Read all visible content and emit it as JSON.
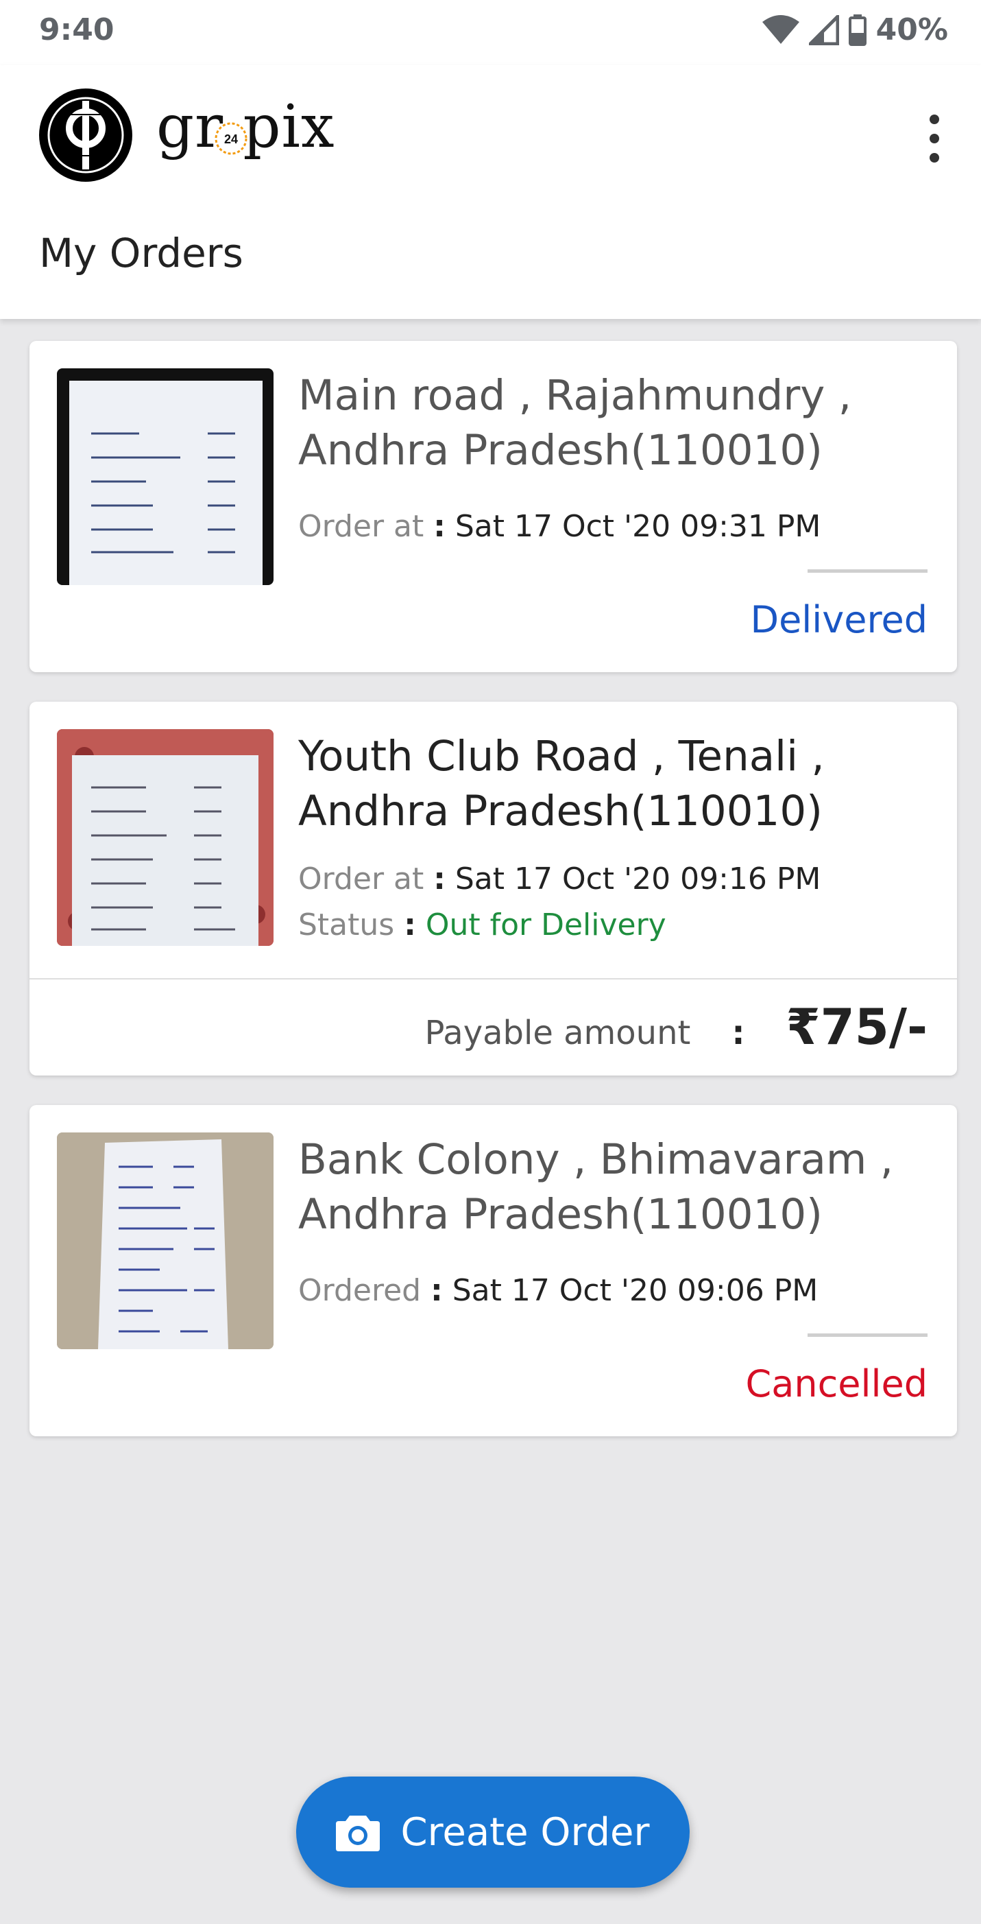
{
  "status_bar": {
    "time": "9:40",
    "battery": "40%"
  },
  "app": {
    "brand": "gr pix",
    "brand_badge": "24",
    "page_title": "My Orders"
  },
  "orders": [
    {
      "address": "Main road , Rajahmundry , Andhra Pradesh(110010)",
      "date_label": "Order at",
      "date_value": "Sat 17 Oct '20 09:31 PM",
      "status": "Delivered",
      "status_color": "#1a56c4"
    },
    {
      "address": "Youth Club Road , Tenali , Andhra Pradesh(110010)",
      "date_label": "Order at",
      "date_value": "Sat 17 Oct '20 09:16 PM",
      "status_label": "Status",
      "status": "Out for Delivery",
      "status_color": "#1e8e3e",
      "payable_label": "Payable amount",
      "payable_amount": "₹75/-"
    },
    {
      "address": "Bank Colony , Bhimavaram , Andhra Pradesh(110010)",
      "date_label": "Ordered",
      "date_value": "Sat 17 Oct '20 09:06 PM",
      "status": "Cancelled",
      "status_color": "#d50f25"
    }
  ],
  "fab": {
    "label": "Create Order",
    "icon": "camera-icon"
  },
  "colors": {
    "primary": "#1976d2",
    "background": "#e8e8ea"
  }
}
